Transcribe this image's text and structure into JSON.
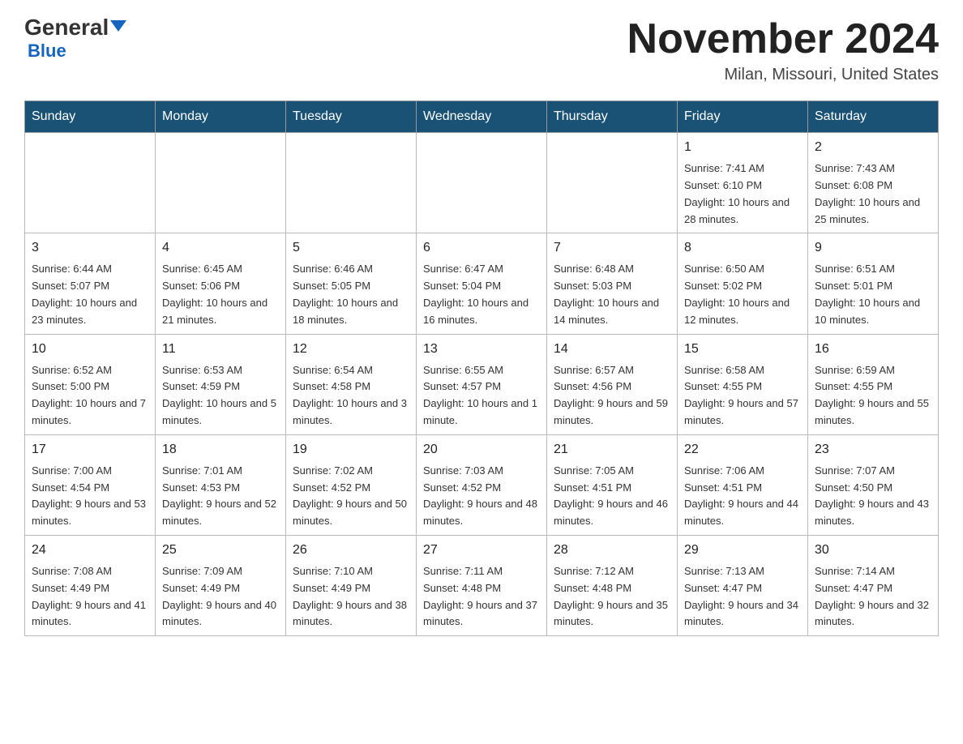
{
  "header": {
    "logo_general": "General",
    "logo_blue": "Blue",
    "month_title": "November 2024",
    "location": "Milan, Missouri, United States"
  },
  "days_of_week": [
    "Sunday",
    "Monday",
    "Tuesday",
    "Wednesday",
    "Thursday",
    "Friday",
    "Saturday"
  ],
  "weeks": [
    [
      {
        "day": "",
        "info": ""
      },
      {
        "day": "",
        "info": ""
      },
      {
        "day": "",
        "info": ""
      },
      {
        "day": "",
        "info": ""
      },
      {
        "day": "",
        "info": ""
      },
      {
        "day": "1",
        "info": "Sunrise: 7:41 AM\nSunset: 6:10 PM\nDaylight: 10 hours and 28 minutes."
      },
      {
        "day": "2",
        "info": "Sunrise: 7:43 AM\nSunset: 6:08 PM\nDaylight: 10 hours and 25 minutes."
      }
    ],
    [
      {
        "day": "3",
        "info": "Sunrise: 6:44 AM\nSunset: 5:07 PM\nDaylight: 10 hours and 23 minutes."
      },
      {
        "day": "4",
        "info": "Sunrise: 6:45 AM\nSunset: 5:06 PM\nDaylight: 10 hours and 21 minutes."
      },
      {
        "day": "5",
        "info": "Sunrise: 6:46 AM\nSunset: 5:05 PM\nDaylight: 10 hours and 18 minutes."
      },
      {
        "day": "6",
        "info": "Sunrise: 6:47 AM\nSunset: 5:04 PM\nDaylight: 10 hours and 16 minutes."
      },
      {
        "day": "7",
        "info": "Sunrise: 6:48 AM\nSunset: 5:03 PM\nDaylight: 10 hours and 14 minutes."
      },
      {
        "day": "8",
        "info": "Sunrise: 6:50 AM\nSunset: 5:02 PM\nDaylight: 10 hours and 12 minutes."
      },
      {
        "day": "9",
        "info": "Sunrise: 6:51 AM\nSunset: 5:01 PM\nDaylight: 10 hours and 10 minutes."
      }
    ],
    [
      {
        "day": "10",
        "info": "Sunrise: 6:52 AM\nSunset: 5:00 PM\nDaylight: 10 hours and 7 minutes."
      },
      {
        "day": "11",
        "info": "Sunrise: 6:53 AM\nSunset: 4:59 PM\nDaylight: 10 hours and 5 minutes."
      },
      {
        "day": "12",
        "info": "Sunrise: 6:54 AM\nSunset: 4:58 PM\nDaylight: 10 hours and 3 minutes."
      },
      {
        "day": "13",
        "info": "Sunrise: 6:55 AM\nSunset: 4:57 PM\nDaylight: 10 hours and 1 minute."
      },
      {
        "day": "14",
        "info": "Sunrise: 6:57 AM\nSunset: 4:56 PM\nDaylight: 9 hours and 59 minutes."
      },
      {
        "day": "15",
        "info": "Sunrise: 6:58 AM\nSunset: 4:55 PM\nDaylight: 9 hours and 57 minutes."
      },
      {
        "day": "16",
        "info": "Sunrise: 6:59 AM\nSunset: 4:55 PM\nDaylight: 9 hours and 55 minutes."
      }
    ],
    [
      {
        "day": "17",
        "info": "Sunrise: 7:00 AM\nSunset: 4:54 PM\nDaylight: 9 hours and 53 minutes."
      },
      {
        "day": "18",
        "info": "Sunrise: 7:01 AM\nSunset: 4:53 PM\nDaylight: 9 hours and 52 minutes."
      },
      {
        "day": "19",
        "info": "Sunrise: 7:02 AM\nSunset: 4:52 PM\nDaylight: 9 hours and 50 minutes."
      },
      {
        "day": "20",
        "info": "Sunrise: 7:03 AM\nSunset: 4:52 PM\nDaylight: 9 hours and 48 minutes."
      },
      {
        "day": "21",
        "info": "Sunrise: 7:05 AM\nSunset: 4:51 PM\nDaylight: 9 hours and 46 minutes."
      },
      {
        "day": "22",
        "info": "Sunrise: 7:06 AM\nSunset: 4:51 PM\nDaylight: 9 hours and 44 minutes."
      },
      {
        "day": "23",
        "info": "Sunrise: 7:07 AM\nSunset: 4:50 PM\nDaylight: 9 hours and 43 minutes."
      }
    ],
    [
      {
        "day": "24",
        "info": "Sunrise: 7:08 AM\nSunset: 4:49 PM\nDaylight: 9 hours and 41 minutes."
      },
      {
        "day": "25",
        "info": "Sunrise: 7:09 AM\nSunset: 4:49 PM\nDaylight: 9 hours and 40 minutes."
      },
      {
        "day": "26",
        "info": "Sunrise: 7:10 AM\nSunset: 4:49 PM\nDaylight: 9 hours and 38 minutes."
      },
      {
        "day": "27",
        "info": "Sunrise: 7:11 AM\nSunset: 4:48 PM\nDaylight: 9 hours and 37 minutes."
      },
      {
        "day": "28",
        "info": "Sunrise: 7:12 AM\nSunset: 4:48 PM\nDaylight: 9 hours and 35 minutes."
      },
      {
        "day": "29",
        "info": "Sunrise: 7:13 AM\nSunset: 4:47 PM\nDaylight: 9 hours and 34 minutes."
      },
      {
        "day": "30",
        "info": "Sunrise: 7:14 AM\nSunset: 4:47 PM\nDaylight: 9 hours and 32 minutes."
      }
    ]
  ]
}
